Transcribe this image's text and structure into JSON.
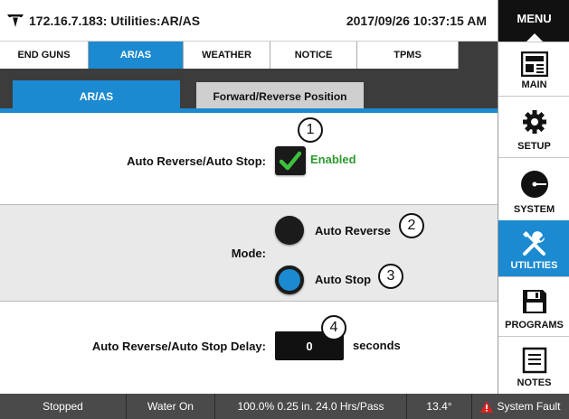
{
  "header": {
    "title": "172.16.7.183: Utilities:AR/AS",
    "datetime": "2017/09/26 10:37:15 AM",
    "logo_icon": "valley-logo-icon"
  },
  "menu": {
    "label": "MENU",
    "items": [
      {
        "label": "MAIN",
        "icon": "main-panel-icon"
      },
      {
        "label": "SETUP",
        "icon": "gear-icon"
      },
      {
        "label": "SYSTEM",
        "icon": "pivot-system-icon"
      },
      {
        "label": "UTILITIES",
        "icon": "tools-icon",
        "active": true
      },
      {
        "label": "PROGRAMS",
        "icon": "floppy-disk-icon"
      },
      {
        "label": "NOTES",
        "icon": "notes-icon"
      }
    ]
  },
  "tabs": [
    {
      "label": "END GUNS"
    },
    {
      "label": "AR/AS",
      "active": true
    },
    {
      "label": "WEATHER"
    },
    {
      "label": "NOTICE"
    },
    {
      "label": "TPMS"
    }
  ],
  "subtabs": [
    {
      "label": "AR/AS",
      "active": true
    },
    {
      "label": "Forward/Reverse Position"
    }
  ],
  "settings": {
    "auto_reverse_stop_label": "Auto Reverse/Auto Stop:",
    "enabled_checked": true,
    "enabled_text": "Enabled",
    "mode_label": "Mode:",
    "mode_options": [
      "Auto Reverse",
      "Auto Stop"
    ],
    "mode_selected": "Auto Stop",
    "delay_label": "Auto Reverse/Auto Stop Delay:",
    "delay_value": "0",
    "delay_unit": "seconds"
  },
  "callouts": [
    "1",
    "2",
    "3",
    "4"
  ],
  "status": {
    "state": "Stopped",
    "water": "Water On",
    "rate": "100.0%  0.25 in.  24.0 Hrs/Pass",
    "angle": "13.4°",
    "fault": "System Fault"
  },
  "colors": {
    "accent": "#1c8ad0",
    "enabled_green": "#2e9a2e",
    "fault_red": "#e02020"
  }
}
